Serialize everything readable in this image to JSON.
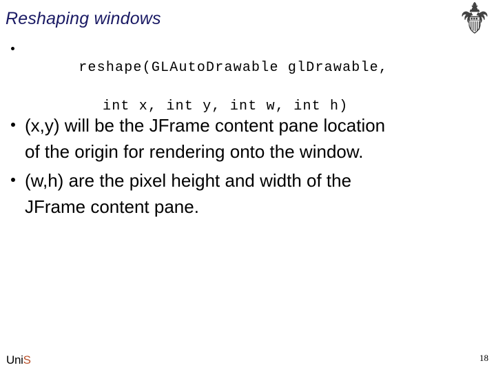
{
  "slide": {
    "title": "Reshaping windows",
    "background_color": "#ffffff",
    "title_color": "#1a1a64"
  },
  "crest": {
    "icon": "heraldic-coat-of-arms-icon",
    "alt": "University coat of arms crest"
  },
  "code": {
    "line1": "reshape(GLAutoDrawable glDrawable,",
    "line2": "int x, int y, int w, int h)"
  },
  "bullets": [
    {
      "line1": "(x,y) will be the JFrame content pane location",
      "line2": "of the origin for rendering onto the window."
    },
    {
      "line1": "(w,h) are the pixel height and width of the",
      "line2": "JFrame content pane."
    }
  ],
  "footer": {
    "logo_uni": "Uni",
    "logo_s": "S",
    "logo_accent_color": "#b8502a",
    "page_number": "18"
  }
}
